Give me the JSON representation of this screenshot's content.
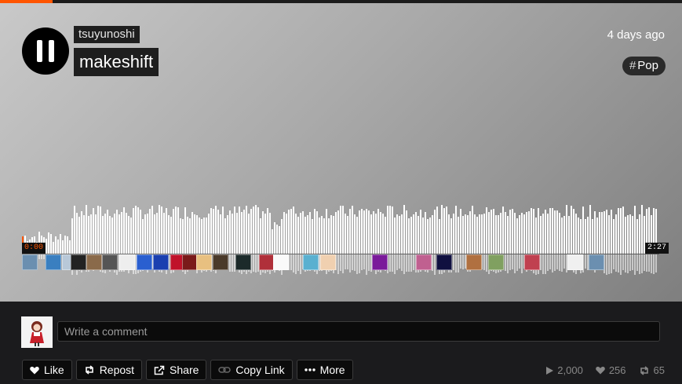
{
  "track": {
    "artist": "tsuyunoshi",
    "title": "makeshift",
    "posted": "4 days ago",
    "genre_tag": "Pop",
    "genre_hash": "#",
    "progress_fraction": 0.077,
    "time_elapsed": "0:00",
    "time_total": "2:27"
  },
  "comment": {
    "placeholder": "Write a comment"
  },
  "actions": {
    "like": "Like",
    "repost": "Repost",
    "share": "Share",
    "copy_link": "Copy Link",
    "more": "More"
  },
  "stats": {
    "plays": "2,000",
    "likes": "256",
    "reposts": "65"
  },
  "colors": {
    "accent": "#ff5500",
    "waveform": "#ffffff",
    "background": "#1b1b1d"
  },
  "icons": {
    "play_pause": "pause-icon",
    "like": "heart-icon",
    "repost": "repost-icon",
    "share": "share-icon",
    "copy_link": "link-icon",
    "more": "ellipsis-icon",
    "plays": "play-icon"
  }
}
